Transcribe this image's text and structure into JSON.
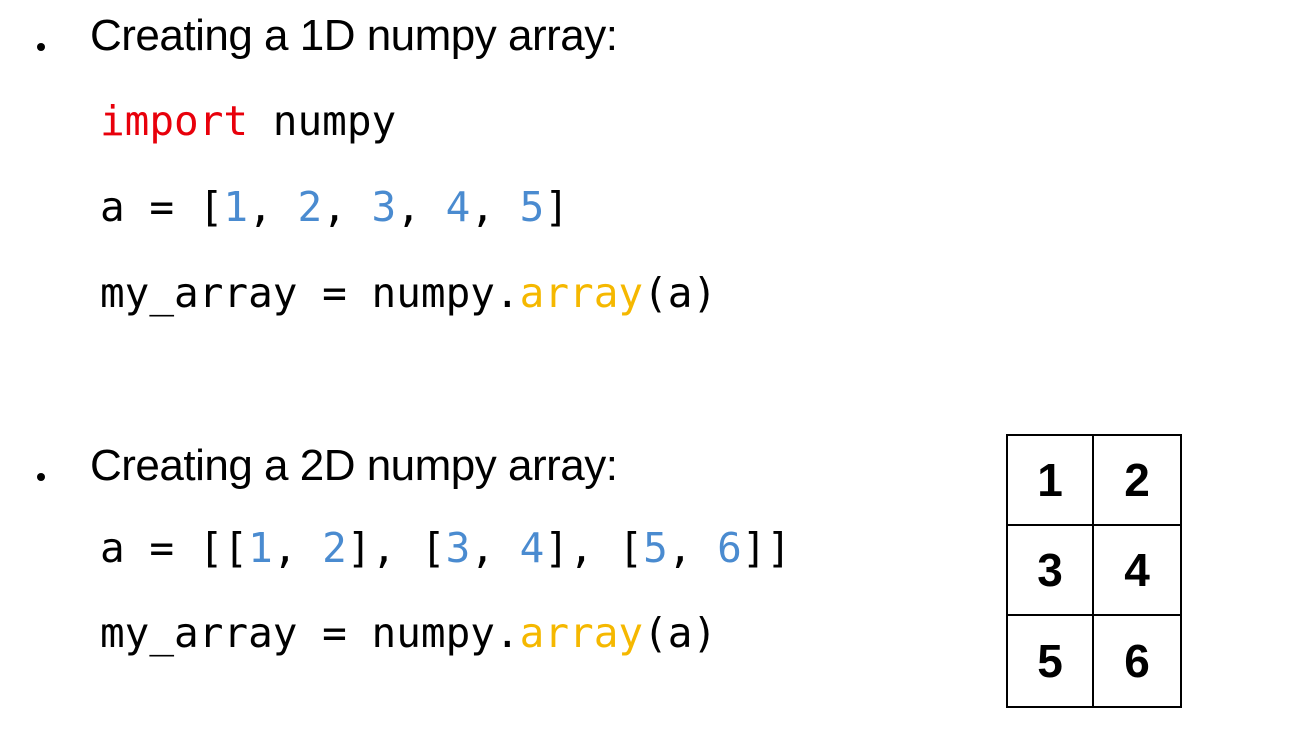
{
  "colors": {
    "keyword": "#e8000b",
    "number": "#4a8bd0",
    "function": "#f5b800",
    "text": "#000000"
  },
  "section_1d": {
    "heading": "Creating a 1D numpy array:",
    "line1": [
      {
        "t": "import",
        "c": "kw"
      },
      {
        "t": " numpy",
        "c": "plain"
      }
    ],
    "line2": [
      {
        "t": "a = [",
        "c": "plain"
      },
      {
        "t": "1",
        "c": "num"
      },
      {
        "t": ", ",
        "c": "plain"
      },
      {
        "t": "2",
        "c": "num"
      },
      {
        "t": ", ",
        "c": "plain"
      },
      {
        "t": "3",
        "c": "num"
      },
      {
        "t": ", ",
        "c": "plain"
      },
      {
        "t": "4",
        "c": "num"
      },
      {
        "t": ", ",
        "c": "plain"
      },
      {
        "t": "5",
        "c": "num"
      },
      {
        "t": "]",
        "c": "plain"
      }
    ],
    "line3": [
      {
        "t": "my_array = numpy.",
        "c": "plain"
      },
      {
        "t": "array",
        "c": "fn"
      },
      {
        "t": "(a)",
        "c": "plain"
      }
    ]
  },
  "section_2d": {
    "heading": "Creating a 2D numpy array:",
    "line1": [
      {
        "t": "a = [[",
        "c": "plain"
      },
      {
        "t": "1",
        "c": "num"
      },
      {
        "t": ", ",
        "c": "plain"
      },
      {
        "t": "2",
        "c": "num"
      },
      {
        "t": "], [",
        "c": "plain"
      },
      {
        "t": "3",
        "c": "num"
      },
      {
        "t": ", ",
        "c": "plain"
      },
      {
        "t": "4",
        "c": "num"
      },
      {
        "t": "], [",
        "c": "plain"
      },
      {
        "t": "5",
        "c": "num"
      },
      {
        "t": ", ",
        "c": "plain"
      },
      {
        "t": "6",
        "c": "num"
      },
      {
        "t": "]]",
        "c": "plain"
      }
    ],
    "line2": [
      {
        "t": "my_array = numpy.",
        "c": "plain"
      },
      {
        "t": "array",
        "c": "fn"
      },
      {
        "t": "(a)",
        "c": "plain"
      }
    ]
  },
  "grid": {
    "cells": [
      "1",
      "2",
      "3",
      "4",
      "5",
      "6"
    ]
  }
}
